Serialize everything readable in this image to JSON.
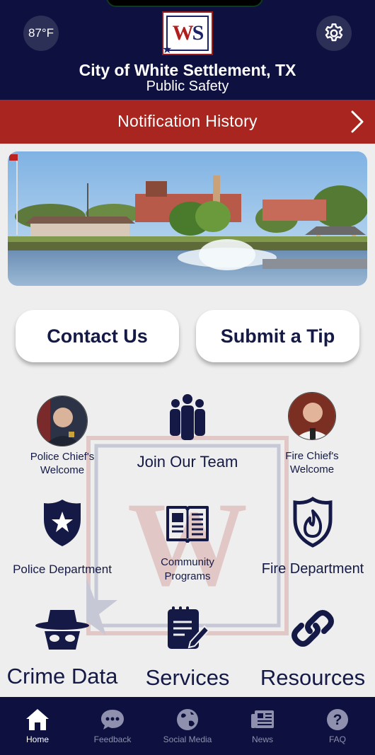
{
  "header": {
    "weather": "87°F",
    "logo_text_w": "W",
    "logo_text_s": "S",
    "city": "City of White Settlement, TX",
    "subtitle": "Public Safety"
  },
  "notification": {
    "label": "Notification History"
  },
  "buttons": {
    "contact": "Contact Us",
    "tip": "Submit a Tip"
  },
  "grid": {
    "police_chief": "Police Chief's Welcome",
    "join_team": "Join Our Team",
    "fire_chief": "Fire Chief's Welcome",
    "police_dept": "Police Department",
    "community": "Community Programs",
    "fire_dept": "Fire Department",
    "crime": "Crime Data",
    "services": "Services",
    "resources": "Resources"
  },
  "nav": {
    "items": [
      {
        "label": "Home",
        "icon": "home-icon",
        "active": true
      },
      {
        "label": "Feedback",
        "icon": "chat-icon",
        "active": false
      },
      {
        "label": "Social Media",
        "icon": "globe-icon",
        "active": false
      },
      {
        "label": "News",
        "icon": "newspaper-icon",
        "active": false
      },
      {
        "label": "FAQ",
        "icon": "question-icon",
        "active": false
      }
    ]
  },
  "colors": {
    "navy": "#0e1140",
    "accent_red": "#a8261f",
    "icon_navy": "#141a45"
  }
}
